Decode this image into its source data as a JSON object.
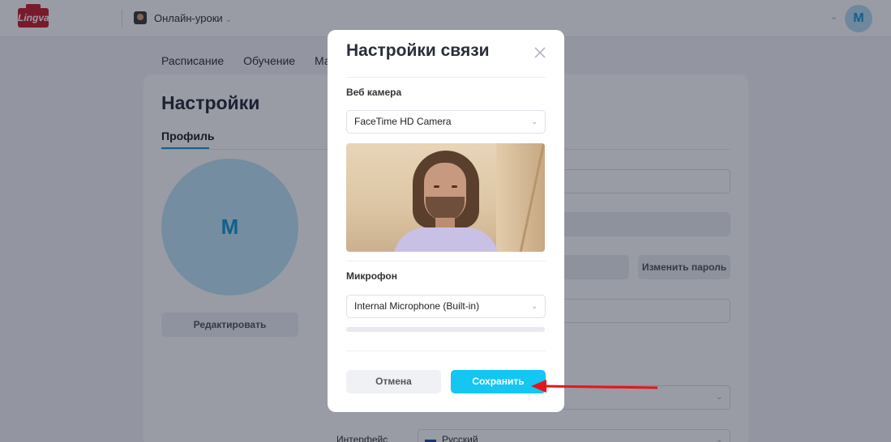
{
  "topbar": {
    "logo_text": "Lingva",
    "school_name": "Онлайн-уроки",
    "user_initial": "M"
  },
  "background": {
    "nav": [
      "Расписание",
      "Обучение",
      "Ма"
    ],
    "page_title": "Настройки",
    "active_tab": "Профиль",
    "avatar_initial": "M",
    "edit_button": "Редактировать",
    "change_password_button": "Изменить пароль",
    "interface_label": "Интерфейс",
    "interface_value": "Русский"
  },
  "modal": {
    "title": "Настройки связи",
    "webcam_label": "Веб камера",
    "webcam_value": "FaceTime HD Camera",
    "mic_label": "Микрофон",
    "mic_value": "Internal Microphone (Built-in)",
    "mic_level": 0,
    "cancel_label": "Отмена",
    "save_label": "Сохранить"
  },
  "colors": {
    "accent": "#14c6f2",
    "annotation_arrow": "#e8141c",
    "avatar_bg": "#bfe5f7",
    "avatar_text": "#1b96cf"
  },
  "icons": [
    "close-icon",
    "chevron-down-icon",
    "school-icon"
  ]
}
